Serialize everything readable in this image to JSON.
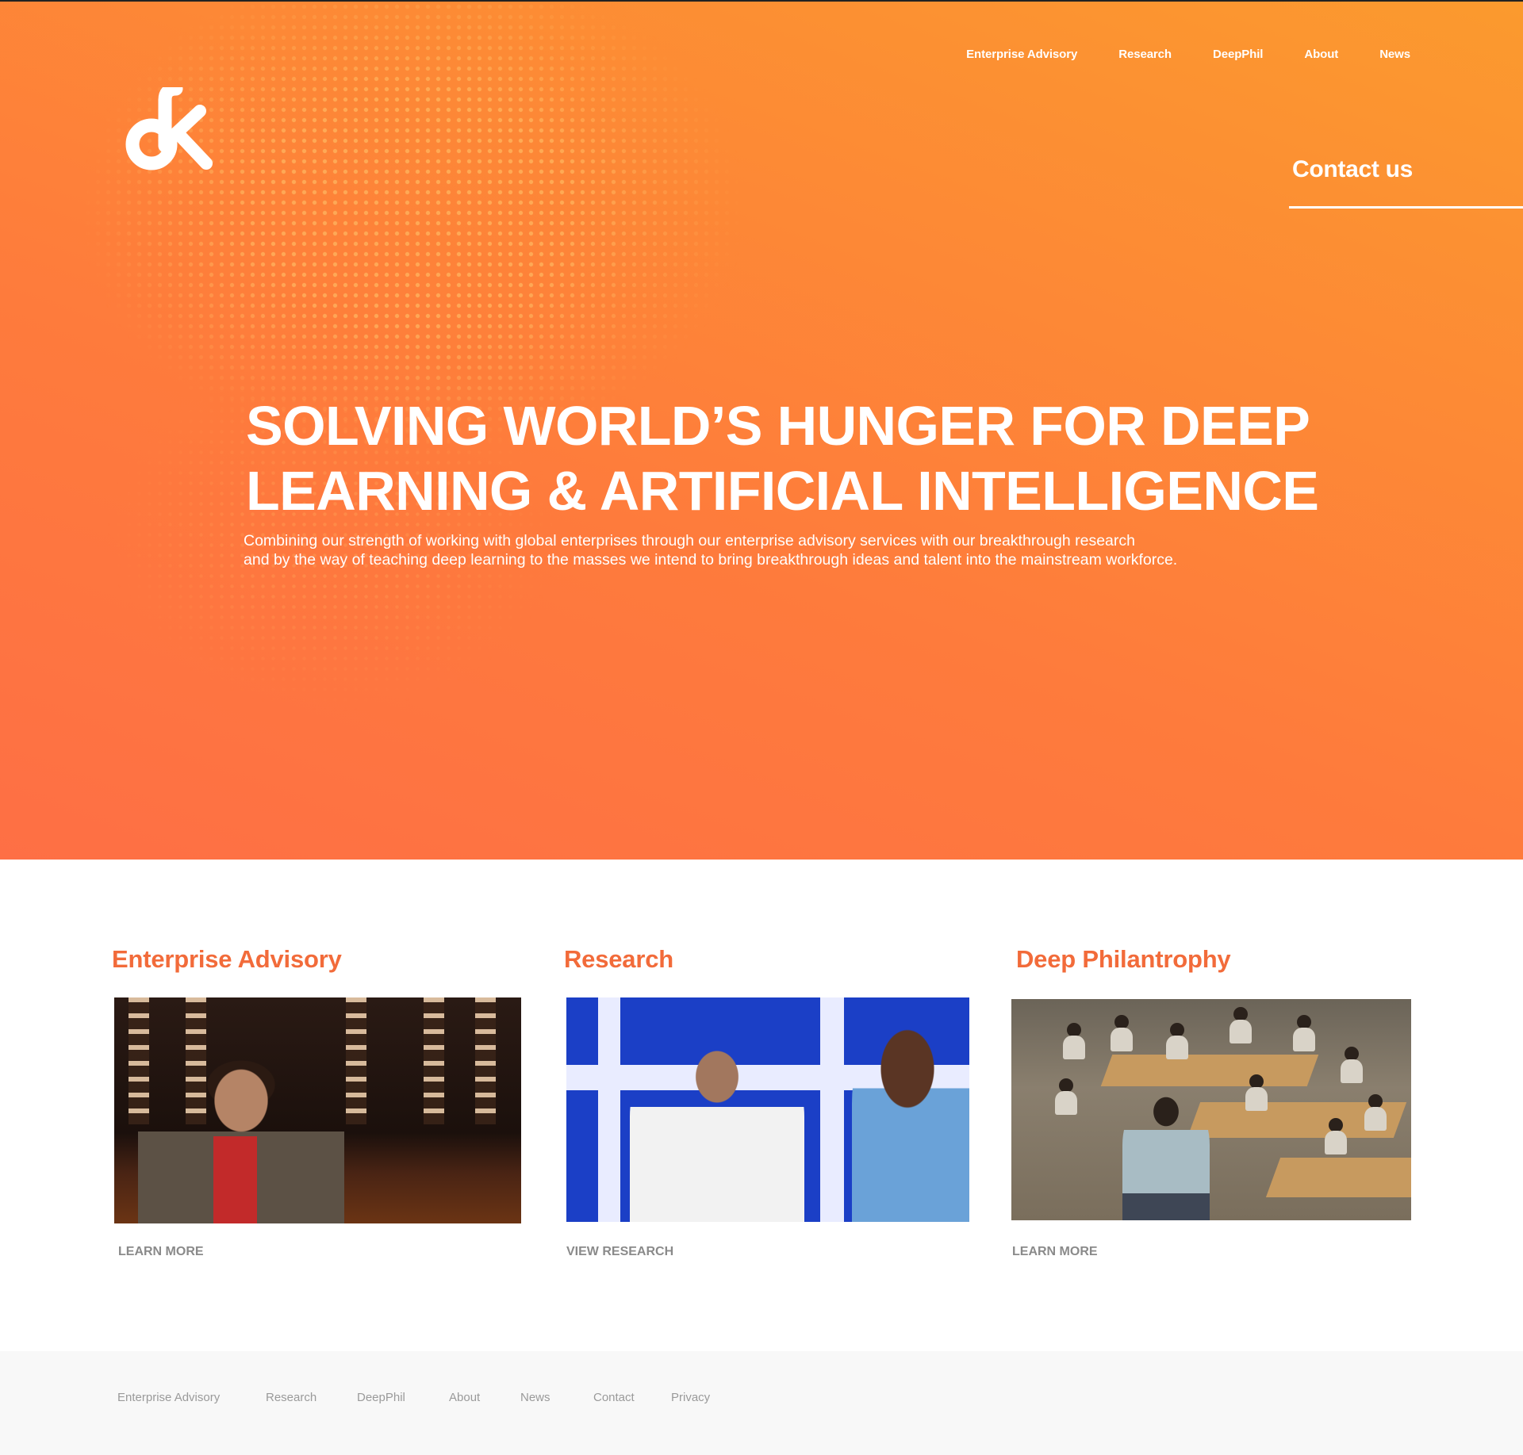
{
  "brand": {
    "logo_icon": "dk-logo-icon"
  },
  "topnav": [
    {
      "label": "Enterprise Advisory"
    },
    {
      "label": "Research"
    },
    {
      "label": "DeepPhil"
    },
    {
      "label": "About"
    },
    {
      "label": "News"
    }
  ],
  "hero": {
    "contact_label": "Contact us",
    "headline_line1": "SOLVING WORLD’S HUNGER FOR DEEP",
    "headline_line2": "LEARNING & ARTIFICIAL INTELLIGENCE",
    "sub_line1": "Combining our strength of working with global enterprises through our enterprise advisory services with our breakthrough research",
    "sub_line2": "and by the way of teaching deep learning to the masses we intend to bring breakthrough ideas and talent into the mainstream workforce."
  },
  "services": [
    {
      "title": "Enterprise Advisory",
      "link": "LEARN MORE"
    },
    {
      "title": "Research",
      "link": "VIEW RESEARCH"
    },
    {
      "title": "Deep Philantrophy",
      "link": "LEARN MORE"
    }
  ],
  "footer": [
    {
      "label": "Enterprise Advisory"
    },
    {
      "label": "Research"
    },
    {
      "label": "DeepPhil"
    },
    {
      "label": "About"
    },
    {
      "label": "News"
    },
    {
      "label": "Contact"
    },
    {
      "label": "Privacy"
    }
  ],
  "colors": {
    "hero_gradient_top": "#fb9a2e",
    "hero_gradient_bottom": "#fe6f45",
    "accent_heading": "#f26b3a",
    "footer_bg": "#f8f8f8"
  }
}
